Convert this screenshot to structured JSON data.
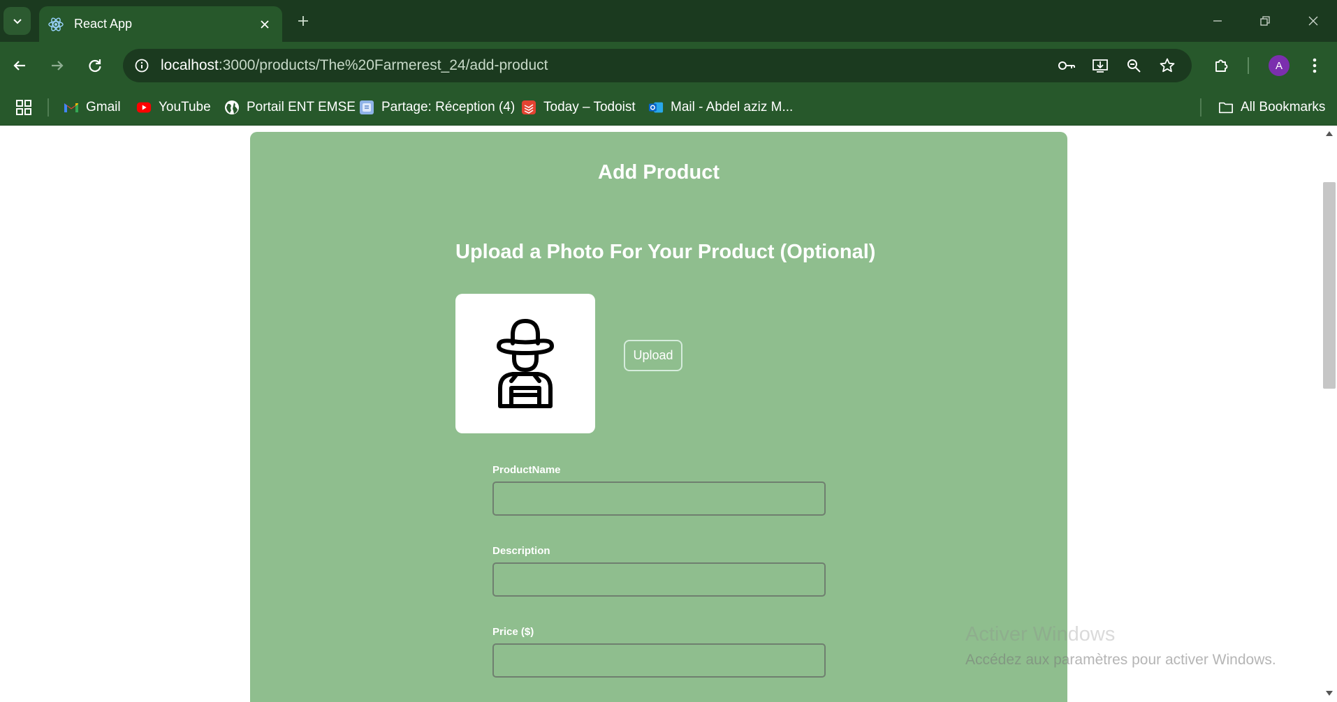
{
  "browser": {
    "tab": {
      "title": "React App"
    },
    "url": {
      "host": "localhost",
      "path": ":3000/products/The%20Farmerest_24/add-product"
    },
    "profile_initial": "A",
    "bookmarks": [
      {
        "label": "Gmail",
        "icon": "gmail-icon"
      },
      {
        "label": "YouTube",
        "icon": "youtube-icon"
      },
      {
        "label": "Portail ENT EMSE",
        "icon": "globe-icon"
      },
      {
        "label": "Partage: Réception (4)",
        "icon": "mail-app-icon"
      },
      {
        "label": "Today – Todoist",
        "icon": "todoist-icon"
      },
      {
        "label": "Mail - Abdel aziz M...",
        "icon": "outlook-icon"
      }
    ],
    "all_bookmarks": "All Bookmarks"
  },
  "page": {
    "title": "Add Product",
    "upload_heading": "Upload a Photo For Your Product (Optional)",
    "upload_button": "Upload",
    "fields": [
      {
        "label": "ProductName",
        "value": ""
      },
      {
        "label": "Description",
        "value": ""
      },
      {
        "label": "Price ($)",
        "value": ""
      }
    ]
  },
  "watermark": {
    "line1": "Activer Windows",
    "line2": "Accédez aux paramètres pour activer Windows."
  },
  "colors": {
    "browser_dark": "#1b3a1f",
    "browser_green": "#27582b",
    "card_green": "#8fbe8e",
    "avatar_purple": "#7b2fae"
  }
}
